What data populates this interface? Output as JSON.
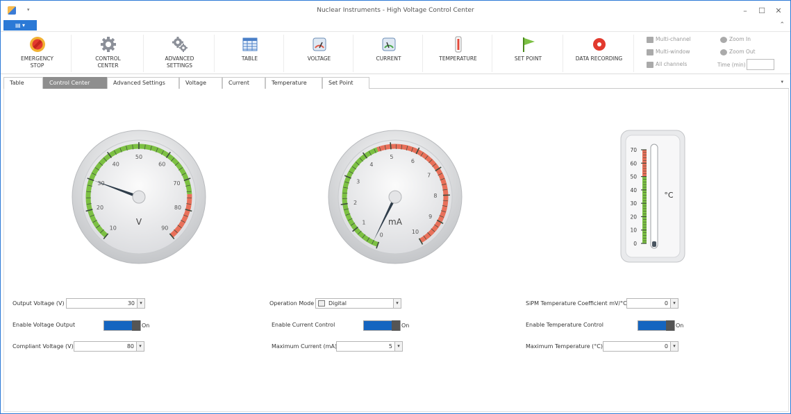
{
  "window": {
    "title": "Nuclear Instruments - High Voltage Control Center",
    "qa_dropdown": "▾",
    "minimize": "–",
    "maximize": "☐",
    "close": "✕",
    "collapse_ribbon": "⌃"
  },
  "file_tab": {
    "label": "▤ ▾"
  },
  "ribbon": {
    "buttons": [
      {
        "label": "EMERGENCY\nSTOP",
        "icon": "emergency-stop-icon"
      },
      {
        "label": "CONTROL\nCENTER",
        "icon": "gear-icon"
      },
      {
        "label": "ADVANCED\nSETTINGS",
        "icon": "gears-icon"
      },
      {
        "label": "TABLE",
        "icon": "table-icon"
      },
      {
        "label": "VOLTAGE",
        "icon": "voltage-gauge-icon"
      },
      {
        "label": "CURRENT",
        "icon": "current-gauge-icon"
      },
      {
        "label": "TEMPERATURE",
        "icon": "thermometer-icon"
      },
      {
        "label": "SET POINT",
        "icon": "flag-icon"
      },
      {
        "label": "DATA RECORDING",
        "icon": "record-icon"
      }
    ],
    "view_options": [
      "Multi-channel",
      "Multi-window",
      "All channels"
    ],
    "zoom_in": "Zoom In",
    "zoom_out": "Zoom Out",
    "time_label": "Time (min)",
    "time_value": ""
  },
  "tabs": [
    {
      "label": "Table"
    },
    {
      "label": "Control Center",
      "close": "✕"
    },
    {
      "label": "Advanced Settings"
    },
    {
      "label": "Voltage"
    },
    {
      "label": "Current"
    },
    {
      "label": "Temperature"
    },
    {
      "label": "Set Point"
    }
  ],
  "tabs_dropdown": "▾",
  "gauges": {
    "voltage": {
      "unit": "V",
      "ticks": [
        "10",
        "20",
        "30",
        "40",
        "50",
        "60",
        "70",
        "80",
        "90"
      ],
      "value": 30,
      "min": 10,
      "max": 90
    },
    "current": {
      "unit": "mA",
      "ticks": [
        "0",
        "1",
        "2",
        "3",
        "4",
        "5",
        "6",
        "7",
        "8",
        "9",
        "10"
      ],
      "value": 0.2,
      "min": 0,
      "max": 10
    },
    "temperature": {
      "unit": "°C",
      "ticks": [
        "0",
        "10",
        "20",
        "30",
        "40",
        "50",
        "60",
        "70"
      ],
      "value": 0,
      "min": 0,
      "max": 70
    }
  },
  "colors": {
    "green": "#7cc043",
    "red": "#e8705a",
    "accent": "#2b79d6"
  },
  "voltage_controls": {
    "output_label": "Output Voltage (V)",
    "output_value": "30",
    "enable_label": "Enable Voltage Output",
    "enable_state": "On",
    "compliant_label": "Compliant Voltage (V)",
    "compliant_value": "80"
  },
  "current_controls": {
    "mode_label": "Operation Mode",
    "mode_value": "Digital",
    "enable_label": "Enable Current Control",
    "enable_state": "On",
    "max_label": "Maximum Current (mA)",
    "max_value": "5"
  },
  "temperature_controls": {
    "coef_label": "SiPM Temperature Coefficient mV/°C",
    "coef_value": "0",
    "enable_label": "Enable Temperature Control",
    "enable_state": "On",
    "max_label": "Maximum Temperature (°C)",
    "max_value": "0"
  }
}
